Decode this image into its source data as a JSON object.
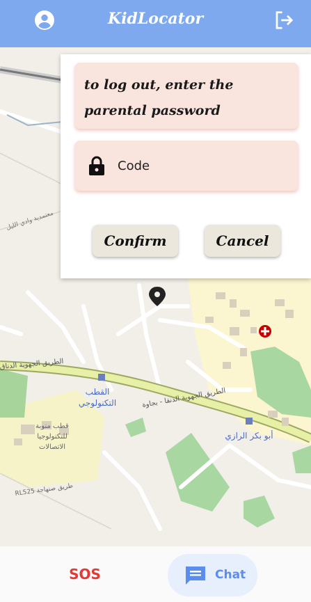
{
  "app": {
    "title": "KidLocator"
  },
  "header": {
    "profile_icon": "account-circle-icon",
    "logout_icon": "logout-icon"
  },
  "dialog": {
    "message": "to log out, enter the parental password",
    "code_placeholder": "Code",
    "confirm_label": "Confirm",
    "cancel_label": "Cancel"
  },
  "map": {
    "labels": {
      "road_main": "الطريق الجهوية الدناق",
      "road_main2": "الطريق الجهوية الدنقا - بجاوة",
      "tech_pole": "القطب\nالتكنولوجي",
      "tech_pole_1": "القطب",
      "tech_pole_2": "التكنولوجي",
      "tech_pole_block": "قطب منوبة\nللتكنولوجيا\nالاتصالات",
      "tech_pole_block_1": "قطب منوبة",
      "tech_pole_block_2": "للتكنولوجيا",
      "tech_pole_block_3": "الاتصالات",
      "razi": "أبو بكر الرازي",
      "wadi": "معتمدية وادي الليل",
      "rl525": "RL525 طريق صنهاجة"
    }
  },
  "bottom_nav": {
    "sos_label": "SOS",
    "chat_label": "Chat"
  },
  "colors": {
    "app_bar": "#7ea9ee",
    "sos": "#e53935",
    "chat": "#5b8def",
    "dialog_field": "#f9e4de"
  }
}
